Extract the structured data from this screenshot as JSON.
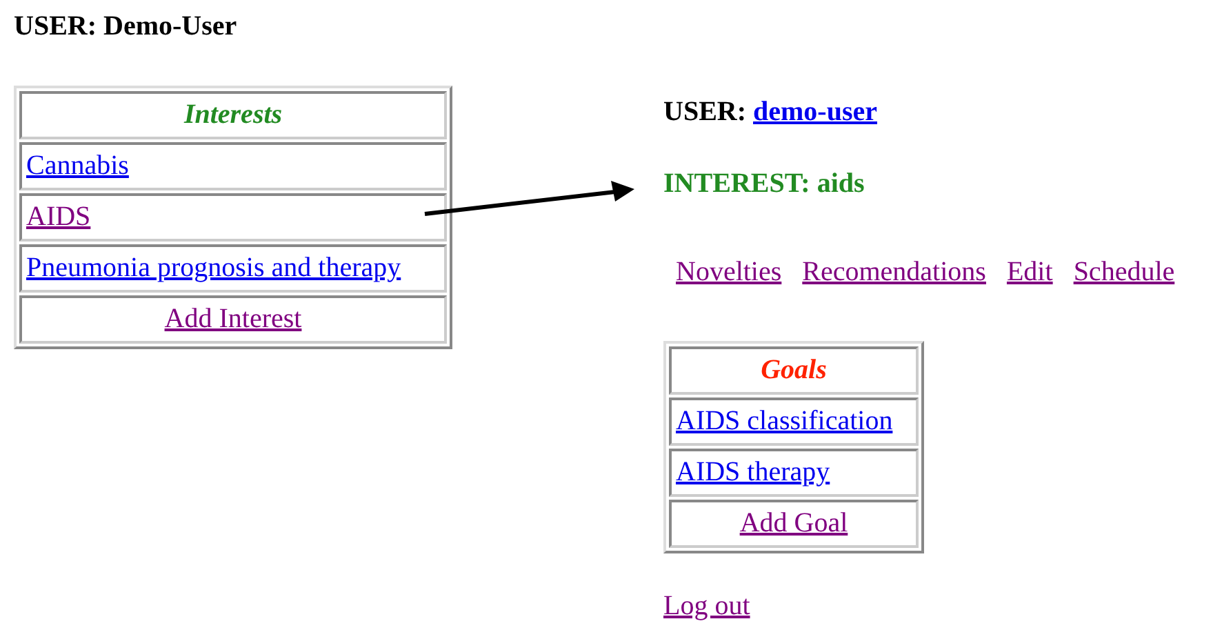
{
  "heading": "USER: Demo-User",
  "interests": {
    "title": "Interests",
    "items": [
      {
        "label": "Cannabis",
        "visited": false
      },
      {
        "label": "AIDS",
        "visited": true
      },
      {
        "label": "Pneumonia prognosis and therapy",
        "visited": false
      }
    ],
    "add": {
      "label": "Add Interest",
      "visited": true
    }
  },
  "user": {
    "label": "USER:",
    "value": "demo-user",
    "visited": false
  },
  "interest": "INTEREST: aids",
  "nav": [
    {
      "label": "Novelties",
      "visited": true
    },
    {
      "label": "Recomendations",
      "visited": true
    },
    {
      "label": "Edit",
      "visited": true
    },
    {
      "label": "Schedule",
      "visited": true
    }
  ],
  "goals": {
    "title": "Goals",
    "items": [
      {
        "label": "AIDS classification",
        "visited": false
      },
      {
        "label": "AIDS therapy",
        "visited": false
      }
    ],
    "add": {
      "label": "Add Goal",
      "visited": true
    }
  },
  "logout": {
    "label": "Log out",
    "visited": true
  }
}
